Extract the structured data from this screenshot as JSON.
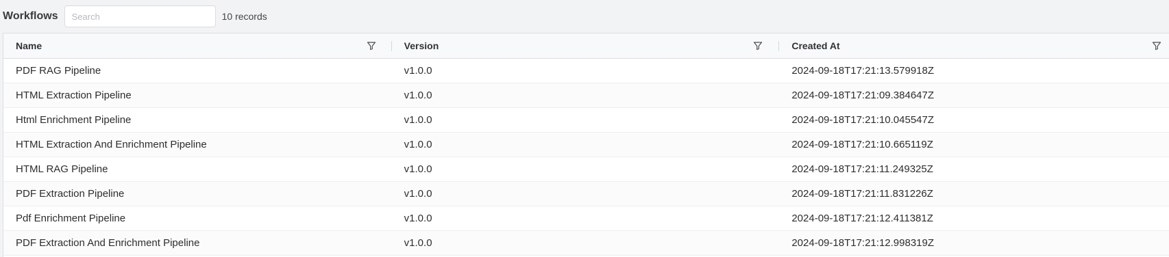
{
  "toolbar": {
    "title": "Workflows",
    "search_placeholder": "Search",
    "record_count": "10 records"
  },
  "table": {
    "columns": [
      {
        "label": "Name"
      },
      {
        "label": "Version"
      },
      {
        "label": "Created At"
      }
    ],
    "rows": [
      {
        "name": "PDF RAG Pipeline",
        "version": "v1.0.0",
        "created_at": "2024-09-18T17:21:13.579918Z"
      },
      {
        "name": "HTML Extraction Pipeline",
        "version": "v1.0.0",
        "created_at": "2024-09-18T17:21:09.384647Z"
      },
      {
        "name": "Html Enrichment Pipeline",
        "version": "v1.0.0",
        "created_at": "2024-09-18T17:21:10.045547Z"
      },
      {
        "name": "HTML Extraction And Enrichment Pipeline",
        "version": "v1.0.0",
        "created_at": "2024-09-18T17:21:10.665119Z"
      },
      {
        "name": "HTML RAG Pipeline",
        "version": "v1.0.0",
        "created_at": "2024-09-18T17:21:11.249325Z"
      },
      {
        "name": "PDF Extraction Pipeline",
        "version": "v1.0.0",
        "created_at": "2024-09-18T17:21:11.831226Z"
      },
      {
        "name": "Pdf Enrichment Pipeline",
        "version": "v1.0.0",
        "created_at": "2024-09-18T17:21:12.411381Z"
      },
      {
        "name": "PDF Extraction And Enrichment Pipeline",
        "version": "v1.0.0",
        "created_at": "2024-09-18T17:21:12.998319Z"
      }
    ]
  }
}
